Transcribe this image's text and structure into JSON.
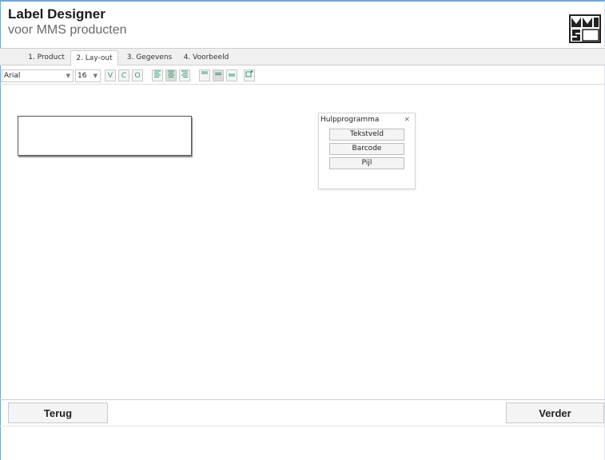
{
  "app": {
    "title": "Label Designer",
    "subtitle": "voor MMS producten"
  },
  "tabs": [
    {
      "label": "1. Product",
      "active": false
    },
    {
      "label": "2. Lay-out",
      "active": true
    },
    {
      "label": "3. Gegevens",
      "active": false
    },
    {
      "label": "4. Voorbeeld",
      "active": false
    }
  ],
  "toolbar": {
    "font": "Arial",
    "size": "16",
    "bold": "V",
    "italic": "C",
    "outline": "O",
    "align_left_icon": "align-left-icon",
    "align_center_icon": "align-center-icon",
    "align_right_icon": "align-right-icon",
    "valign_top_icon": "valign-top-icon",
    "valign_middle_icon": "valign-middle-icon",
    "valign_bottom_icon": "valign-bottom-icon",
    "frame_icon": "frame-icon"
  },
  "tool_panel": {
    "title": "Hulpprogramma",
    "close": "×",
    "buttons": [
      "Tekstveld",
      "Barcode",
      "Pijl"
    ]
  },
  "footer": {
    "back": "Terug",
    "next": "Verder"
  },
  "colors": {
    "accent": "#2a9a6a",
    "frame": "#6ea8d6"
  }
}
